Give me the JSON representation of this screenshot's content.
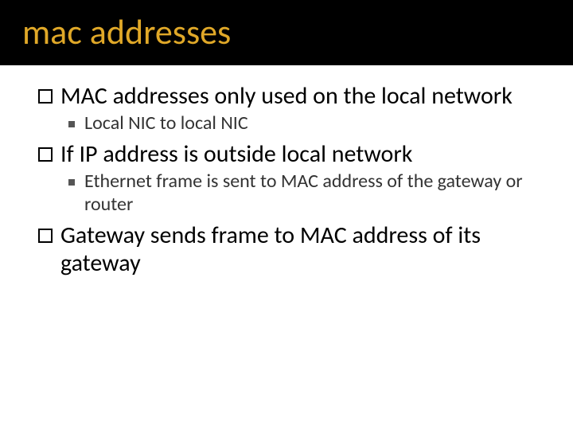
{
  "title": "mac addresses",
  "bullets": {
    "b1": "MAC addresses only used on the local network",
    "b1a": "Local NIC to local NIC",
    "b2": "If IP address is outside local network",
    "b2a": "Ethernet frame is sent to MAC address of the gateway or router",
    "b3": "Gateway sends frame to MAC address of its gateway"
  }
}
